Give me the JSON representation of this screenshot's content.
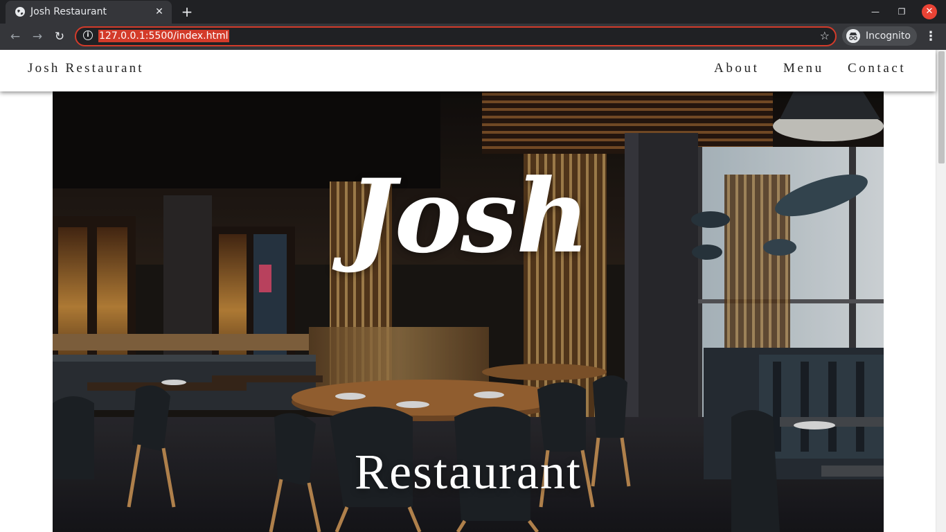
{
  "browser": {
    "tab_title": "Josh Restaurant",
    "url": "127.0.0.1:5500/index.html",
    "profile_label": "Incognito",
    "icons": {
      "tab_favicon": "globe-icon",
      "tab_close": "close-icon",
      "new_tab": "plus-icon",
      "back": "arrow-left-icon",
      "forward": "arrow-right-icon",
      "reload": "reload-icon",
      "site_info": "info-icon",
      "bookmark": "star-icon",
      "incognito": "incognito-icon",
      "menu": "kebab-menu-icon",
      "minimize": "minimize-icon",
      "maximize": "maximize-icon",
      "close_window": "close-window-icon"
    },
    "colors": {
      "url_highlight": "#d33b2a",
      "close_window": "#ea4335"
    }
  },
  "site": {
    "brand": "Josh Restaurant",
    "nav": [
      {
        "label": "About"
      },
      {
        "label": "Menu"
      },
      {
        "label": "Contact"
      }
    ]
  },
  "hero": {
    "title": "Josh",
    "subtitle": "Restaurant",
    "background": "restaurant-interior-photo"
  }
}
